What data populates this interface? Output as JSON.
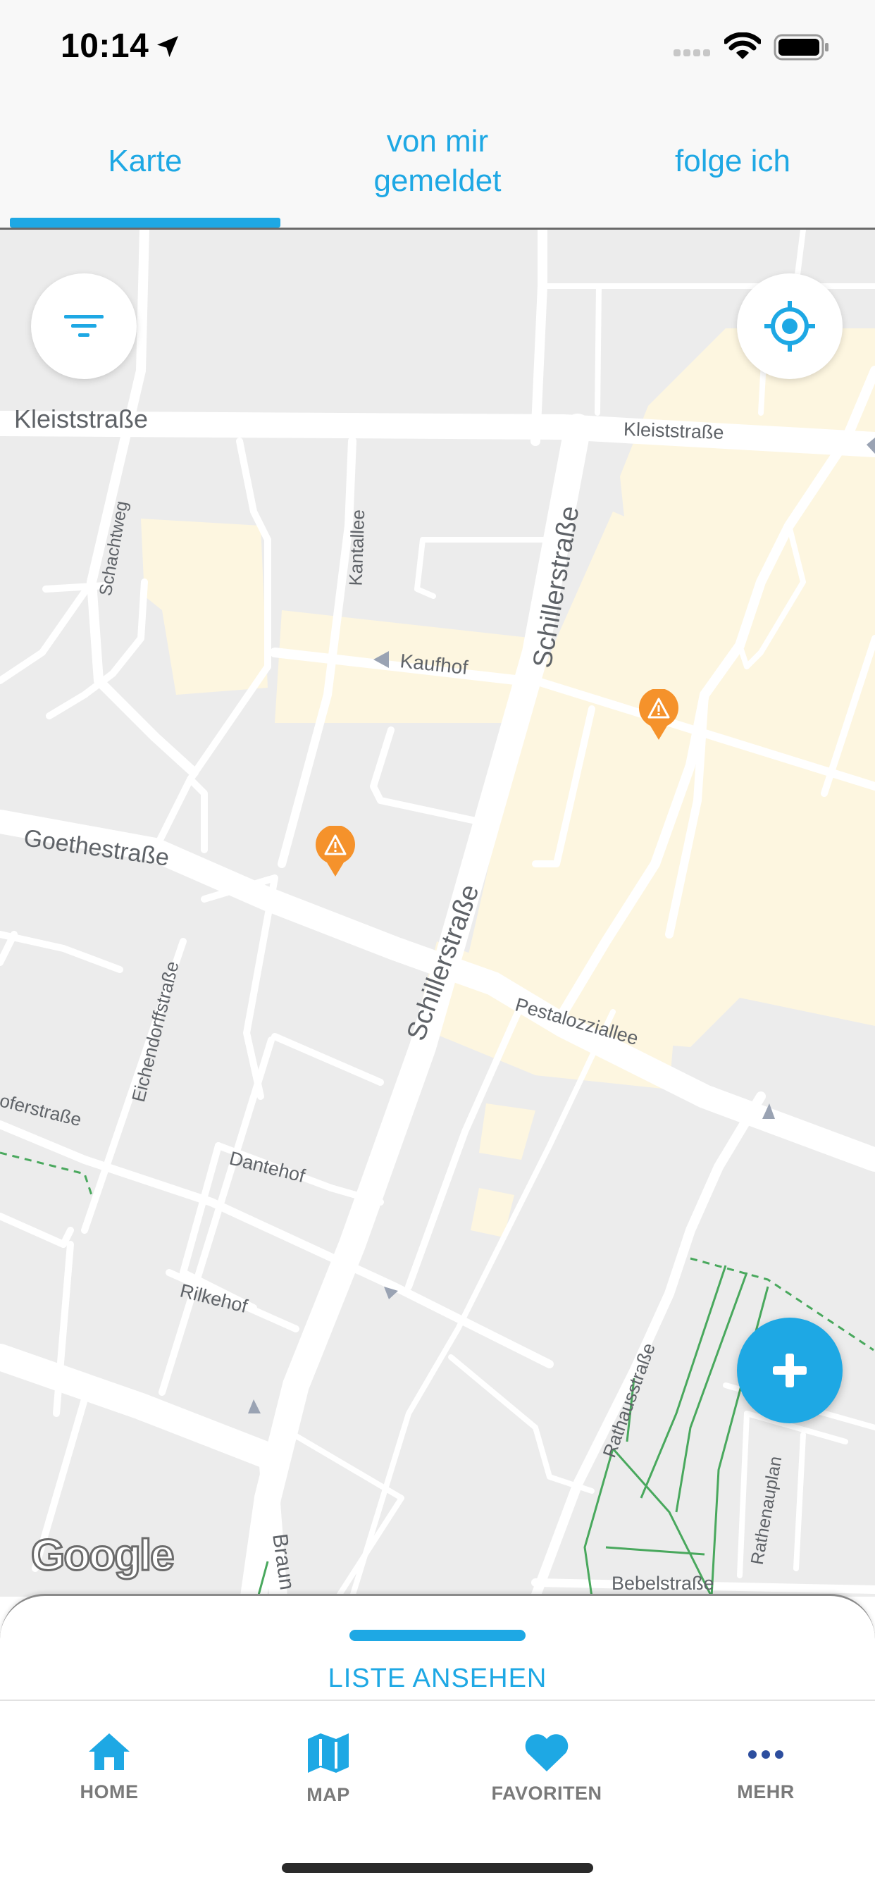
{
  "status_bar": {
    "time": "10:14"
  },
  "tabs": [
    {
      "label": "Karte",
      "active": true
    },
    {
      "label": "von mir\ngemeldet",
      "active": false
    },
    {
      "label": "folge ich",
      "active": false
    }
  ],
  "colors": {
    "accent": "#1ea8e4",
    "marker": "#f5922b",
    "map_background": "#ececec",
    "building_highlight": "#fdf6e0"
  },
  "map": {
    "streets": [
      "Kleiststraße",
      "Kleiststraße",
      "Schachtweg",
      "Kantallee",
      "Schillerstraße",
      "Kaufhof",
      "Goethestraße",
      "Schillerstraße",
      "Pestalozziallee",
      "Eichendorffstraße",
      "oferstraße",
      "Dantehof",
      "Rilkehof",
      "Rathausstraße",
      "Rathenauplan",
      "Braun",
      "Bebelstraße"
    ],
    "filter_icon": "filter-icon",
    "locate_icon": "crosshair-icon",
    "markers": [
      "warning-marker-icon",
      "warning-marker-icon"
    ],
    "attribution": "Google",
    "add_icon": "plus-icon"
  },
  "sheet": {
    "label": "LISTE ANSEHEN"
  },
  "nav": [
    {
      "label": "HOME",
      "icon": "home-icon"
    },
    {
      "label": "MAP",
      "icon": "map-icon"
    },
    {
      "label": "FAVORITEN",
      "icon": "heart-icon"
    },
    {
      "label": "MEHR",
      "icon": "more-icon"
    }
  ]
}
